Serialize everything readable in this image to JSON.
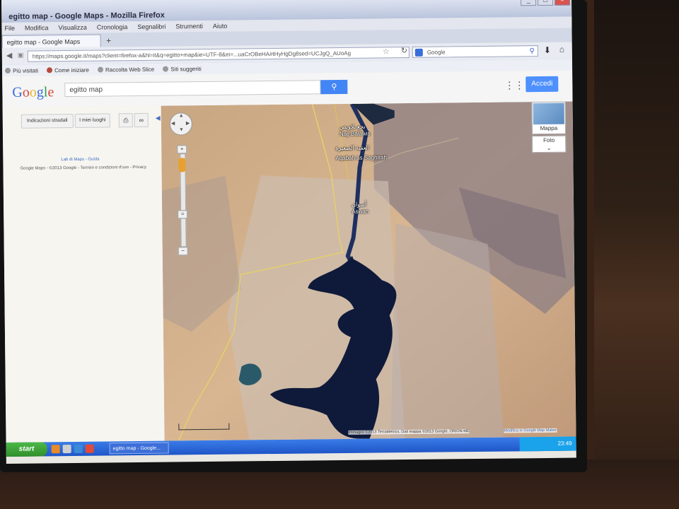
{
  "window": {
    "title": "egitto map - Google Maps - Mozilla Firefox"
  },
  "menu": [
    "File",
    "Modifica",
    "Visualizza",
    "Cronologia",
    "Segnalibri",
    "Strumenti",
    "Aiuto"
  ],
  "tab": {
    "label": "egitto map - Google Maps",
    "new_tab": "+"
  },
  "nav": {
    "url": "https://maps.google.it/maps?client=firefox-a&hl=it&q=egitto+map&ie=UTF-8&ei=...uaCrOBeHA#tHyHgDg8sed=UCJgQ_AUoAg",
    "search_engine": "Google",
    "search_placeholder": "Google"
  },
  "bookmarks": [
    "Più visitati",
    "Come iniziare",
    "Raccolta Web Slice",
    "Siti suggeriti"
  ],
  "google": {
    "logo": "Google",
    "query": "egitto map",
    "search_icon": "search-icon",
    "signin": "Accedi"
  },
  "panel": {
    "directions_button": "Indicazioni stradali",
    "my_places_button": "I miei luoghi",
    "labs_link": "Lab di Maps - Guida",
    "legal": "Google Maps - ©2013 Google - Termini e condizioni d'uso - Privacy"
  },
  "map": {
    "map_button": "Mappa",
    "photo_button": "Foto",
    "labels": {
      "naga_arabic": "نجع بلاويص",
      "naga": "Najj Balawis",
      "aqaba_arabic": "العقبة الصغيرة",
      "aqaba": "Aqabah as Saghirah",
      "aswan_arabic": "أسوان",
      "aswan": "Aswan"
    },
    "attribution": "Immagini ©2013 TerraMetrics, Dati mappa ©2013 Google, ORION-ME",
    "report": "Modifica in Google Map Maker"
  },
  "taskbar": {
    "start": "start",
    "task": "egitto map - Google...",
    "clock": "23:49"
  }
}
